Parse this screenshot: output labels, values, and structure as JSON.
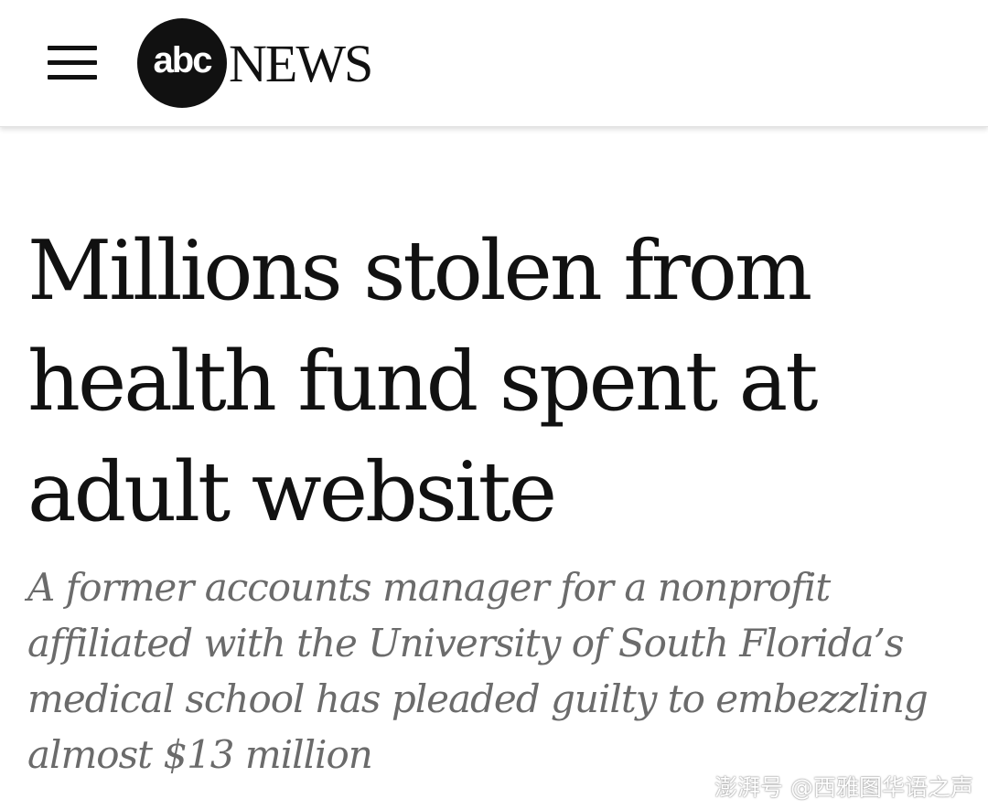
{
  "header": {
    "logo": {
      "abc": "abc",
      "news": "NEWS"
    }
  },
  "article": {
    "headline": "Millions stolen from health fund spent at adult website",
    "subheadline": "A former accounts manager for a nonprofit affiliated with the University of South Florida’s medical school has pleaded guilty to embezzling almost $13 million"
  },
  "watermark": {
    "text": "澎湃号 @西雅图华语之声"
  },
  "icons": {
    "menu": "hamburger-menu-icon"
  },
  "colors": {
    "logo": "#111111",
    "headline": "#111111",
    "subheadline": "#6b6b6b",
    "background": "#ffffff"
  }
}
